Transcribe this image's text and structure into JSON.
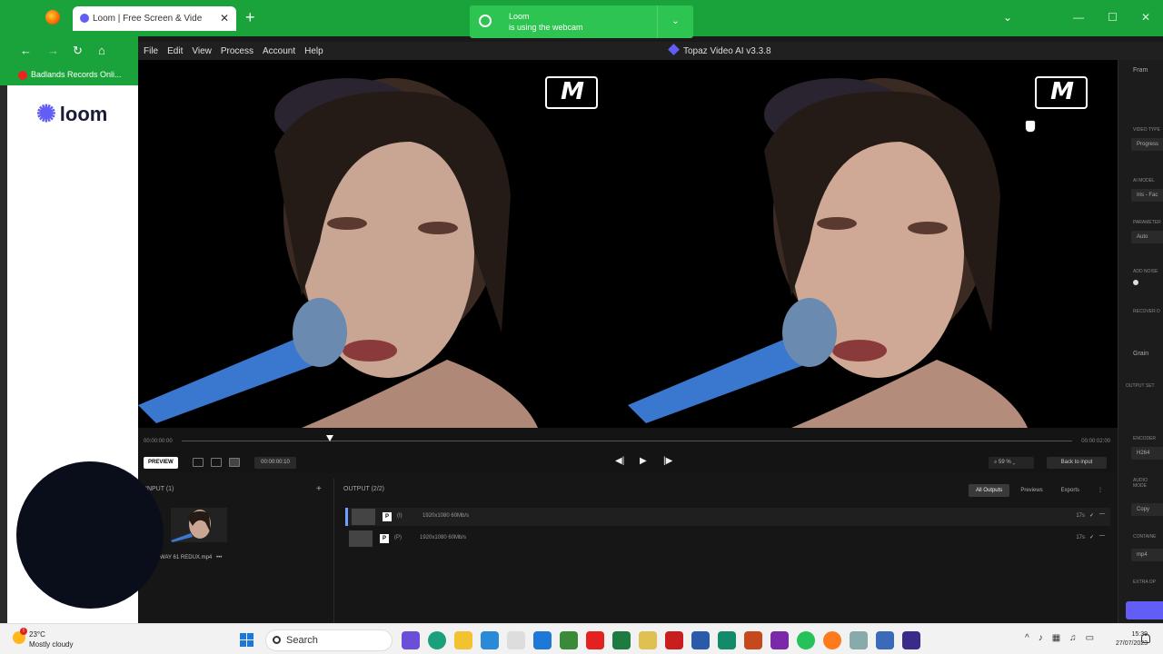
{
  "browser": {
    "tab_title": "Loom | Free Screen & Video Recording",
    "bookmark": "Badlands Records Onli...",
    "loom_brand": "loom"
  },
  "notification": {
    "app": "Loom",
    "message": "is using the webcam"
  },
  "topaz": {
    "title": "Topaz Video AI  v3.3.8",
    "menu": [
      "File",
      "Edit",
      "View",
      "Process",
      "Account",
      "Help"
    ],
    "timeline_start": "00:00:00:00",
    "timeline_end": "00:00:02:00",
    "preview_label": "PREVIEW",
    "timecode": "00:00:00:10",
    "zoom": "59 %",
    "back_label": "Back to input",
    "input_header": "INPUT (1)",
    "input_file": "WAY 61 REDUX.mp4",
    "output_header": "OUTPUT (2/2)",
    "output_tabs": [
      "All Outputs",
      "Previews",
      "Exports"
    ],
    "outputs": [
      {
        "badge": "P",
        "label": "(I)",
        "spec": "1920x1080  60Mb/s",
        "time": "17s"
      },
      {
        "badge": "P",
        "label": "(P)",
        "spec": "1920x1080  60Mb/s",
        "time": "17s"
      }
    ],
    "sidebar": {
      "frame": "Fram",
      "video_type_label": "VIDEO TYPE",
      "video_type": "Progress",
      "ai_model_label": "AI MODEL",
      "ai_model": "Iris - Fac",
      "parameters_label": "PARAMETER",
      "parameters": "Auto",
      "add_noise_label": "ADD NOISE",
      "recover_label": "RECOVER D",
      "grain_label": "Grain",
      "output_settings_label": "OUTPUT SET",
      "encoder_label": "ENCODER",
      "encoder": "H264",
      "audio_label": "AUDIO MODE",
      "audio_mode": "Copy",
      "container_label": "CONTAINE",
      "container": "mp4",
      "extra_label": "EXTRA OP"
    }
  },
  "taskbar": {
    "temp": "23°C",
    "weather": "Mostly cloudy",
    "search": "Search",
    "time": "15:39",
    "date": "27/07/2023"
  },
  "colors": {
    "chrome_green": "#1aa33a",
    "loom_purple": "#625df5",
    "topaz_bg": "#161616"
  }
}
